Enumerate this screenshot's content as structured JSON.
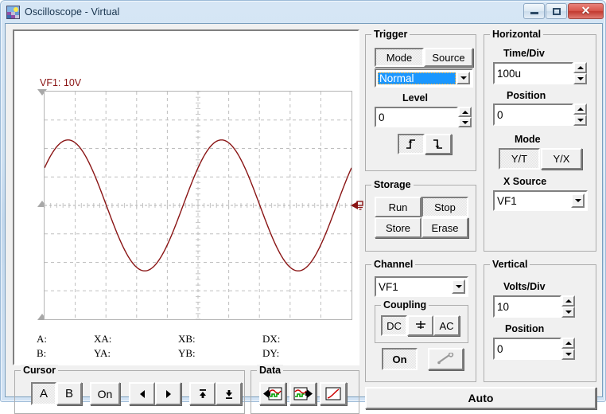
{
  "window": {
    "title": "Oscilloscope - Virtual",
    "icon": "oscilloscope-icon",
    "minimize_label": "Minimize",
    "maximize_label": "Maximize",
    "close_label": "Close"
  },
  "display": {
    "channel_label": "VF1: 10V",
    "trace_color": "#8a1515",
    "grid_color": "#bfbfbf",
    "background": "#ffffff",
    "measurements": [
      {
        "label": "A:",
        "value": ""
      },
      {
        "label": "XA:",
        "value": ""
      },
      {
        "label": "XB:",
        "value": ""
      },
      {
        "label": "DX:",
        "value": ""
      },
      {
        "label": "B:",
        "value": ""
      },
      {
        "label": "YA:",
        "value": ""
      },
      {
        "label": "YB:",
        "value": ""
      },
      {
        "label": "DY:",
        "value": ""
      }
    ]
  },
  "chart_data": {
    "type": "line",
    "title": "VF1: 10V",
    "xlabel": "",
    "ylabel": "",
    "series": [
      {
        "name": "VF1",
        "color": "#8a1515",
        "waveform": "sine",
        "amplitude_div": 2.3,
        "cycles": 2.0,
        "phase_deg": 35,
        "volts_per_div": 10,
        "time_per_div": "100u"
      }
    ],
    "grid": true,
    "x_divisions": 10,
    "y_divisions": 8,
    "center_line_div": 4
  },
  "trigger": {
    "legend": "Trigger",
    "tabs": [
      {
        "label": "Mode",
        "active": true
      },
      {
        "label": "Source",
        "active": false
      }
    ],
    "mode_value": "Normal",
    "level_label": "Level",
    "level_value": "0",
    "edge_buttons": [
      {
        "name": "rising-edge",
        "active": true
      },
      {
        "name": "falling-edge",
        "active": false
      }
    ]
  },
  "storage": {
    "legend": "Storage",
    "buttons": [
      {
        "label": "Run",
        "active": false
      },
      {
        "label": "Stop",
        "active": true
      },
      {
        "label": "Store",
        "active": false
      },
      {
        "label": "Erase",
        "active": false
      }
    ]
  },
  "channel": {
    "legend": "Channel",
    "selected": "VF1",
    "coupling": {
      "legend": "Coupling",
      "buttons": [
        {
          "label": "DC",
          "active": true
        },
        {
          "label": "",
          "active": false,
          "icon": "ground-icon"
        },
        {
          "label": "AC",
          "active": false
        }
      ]
    },
    "on_label": "On",
    "on_active": true,
    "probe_icon": "probe-icon",
    "probe_enabled": false
  },
  "horizontal": {
    "legend": "Horizontal",
    "time_div_label": "Time/Div",
    "time_div_value": "100u",
    "position_label": "Position",
    "position_value": "0",
    "mode_label": "Mode",
    "mode_buttons": [
      {
        "label": "Y/T",
        "active": true
      },
      {
        "label": "Y/X",
        "active": false
      }
    ],
    "x_source_label": "X Source",
    "x_source_value": "VF1"
  },
  "vertical": {
    "legend": "Vertical",
    "volts_div_label": "Volts/Div",
    "volts_div_value": "10",
    "position_label": "Position",
    "position_value": "0"
  },
  "cursor": {
    "legend": "Cursor",
    "buttons": [
      {
        "label": "A",
        "active": true,
        "name": "cursor-a-button"
      },
      {
        "label": "B",
        "active": false,
        "name": "cursor-b-button"
      },
      {
        "label": "On",
        "active": false,
        "name": "cursor-on-button"
      }
    ],
    "nav": [
      {
        "name": "cursor-left-button",
        "icon": "triangle-left-icon"
      },
      {
        "name": "cursor-right-button",
        "icon": "triangle-right-icon"
      },
      {
        "name": "cursor-up-button",
        "icon": "triangle-up-bar-icon"
      },
      {
        "name": "cursor-down-button",
        "icon": "triangle-down-bar-icon"
      }
    ]
  },
  "data": {
    "legend": "Data",
    "buttons": [
      {
        "name": "import-data-button",
        "icon": "arrow-into-chart-icon"
      },
      {
        "name": "export-data-button",
        "icon": "arrow-out-of-chart-icon"
      },
      {
        "name": "show-graph-button",
        "icon": "red-curve-icon"
      }
    ]
  },
  "auto": {
    "label": "Auto"
  }
}
